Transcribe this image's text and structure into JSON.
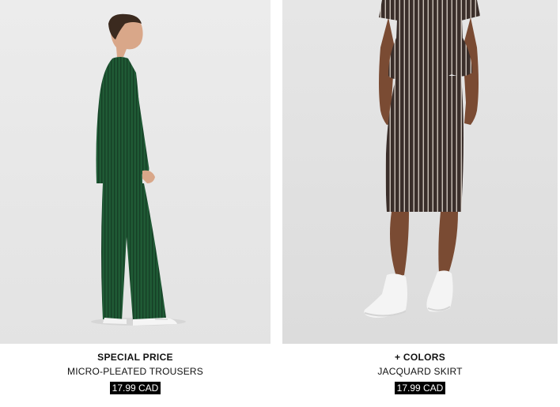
{
  "colors": {
    "background": "#ffffff",
    "photo_bg_left": "#e9e9e9",
    "photo_bg_right": "#e4e4e4",
    "price_bg": "#000000",
    "price_text": "#ffffff"
  },
  "products": [
    {
      "badge": "SPECIAL PRICE",
      "name": "MICRO-PLEATED TROUSERS",
      "price": "17.99 CAD",
      "image_description": "model in dark green pleated long top and wide trousers"
    },
    {
      "badge": "+ COLORS",
      "name": "JACQUARD SKIRT",
      "price": "17.99 CAD",
      "image_description": "model in striped peplum top and jacquard pencil skirt with white sneakers"
    }
  ]
}
